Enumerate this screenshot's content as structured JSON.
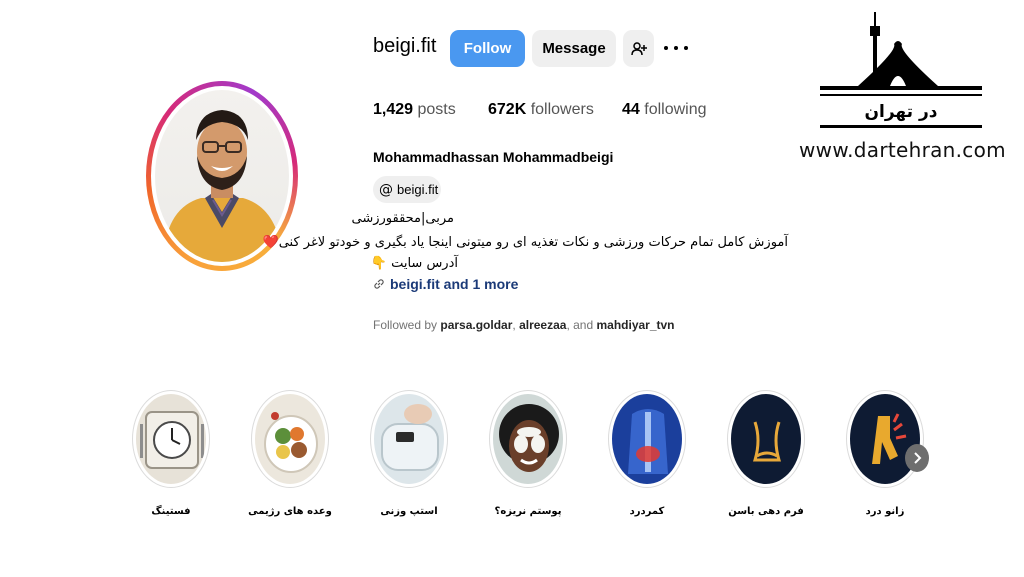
{
  "profile": {
    "username": "beigi.fit",
    "follow_label": "Follow",
    "message_label": "Message",
    "posts_count": "1,429",
    "posts_label": "posts",
    "followers_count": "672K",
    "followers_label": "followers",
    "following_count": "44",
    "following_label": "following",
    "full_name": "Mohammadhassan Mohammadbeigi",
    "threads_handle": "beigi.fit",
    "bio": [
      "مربی|محققورزشی",
      "آموزش کامل تمام حرکات ورزشی و نکات تغذیه ای رو میتونی اینجا یاد بگیری و خودتو لاغر کنی❤️",
      "آدرس سایت 👇"
    ],
    "link_text": "beigi.fit and 1 more",
    "followed_by_prefix": "Followed by",
    "followed_by": [
      "parsa.goldar",
      "alreezaa",
      "mahdiyar_tvn"
    ],
    "followed_by_sep": ", ",
    "followed_by_and": ", and "
  },
  "highlights": [
    {
      "label": "فستینگ",
      "icon": "clock-plate-icon"
    },
    {
      "label": "وعده های رژیمی",
      "icon": "healthy-food-bowl-icon"
    },
    {
      "label": "استپ وزنی",
      "icon": "bathroom-scale-icon"
    },
    {
      "label": "پوستم نریزه؟",
      "icon": "face-mask-icon"
    },
    {
      "label": "کمردرد",
      "icon": "spine-icon"
    },
    {
      "label": "فرم دهی باسن",
      "icon": "waist-outline-icon"
    },
    {
      "label": "زانو درد",
      "icon": "knee-pain-icon"
    }
  ],
  "watermark": {
    "logo_text": "در تهران",
    "url": "www.dartehran.com"
  },
  "colors": {
    "follow_blue": "#4a98f0",
    "link_blue": "#1b3a78",
    "gray_button": "#efefef"
  }
}
